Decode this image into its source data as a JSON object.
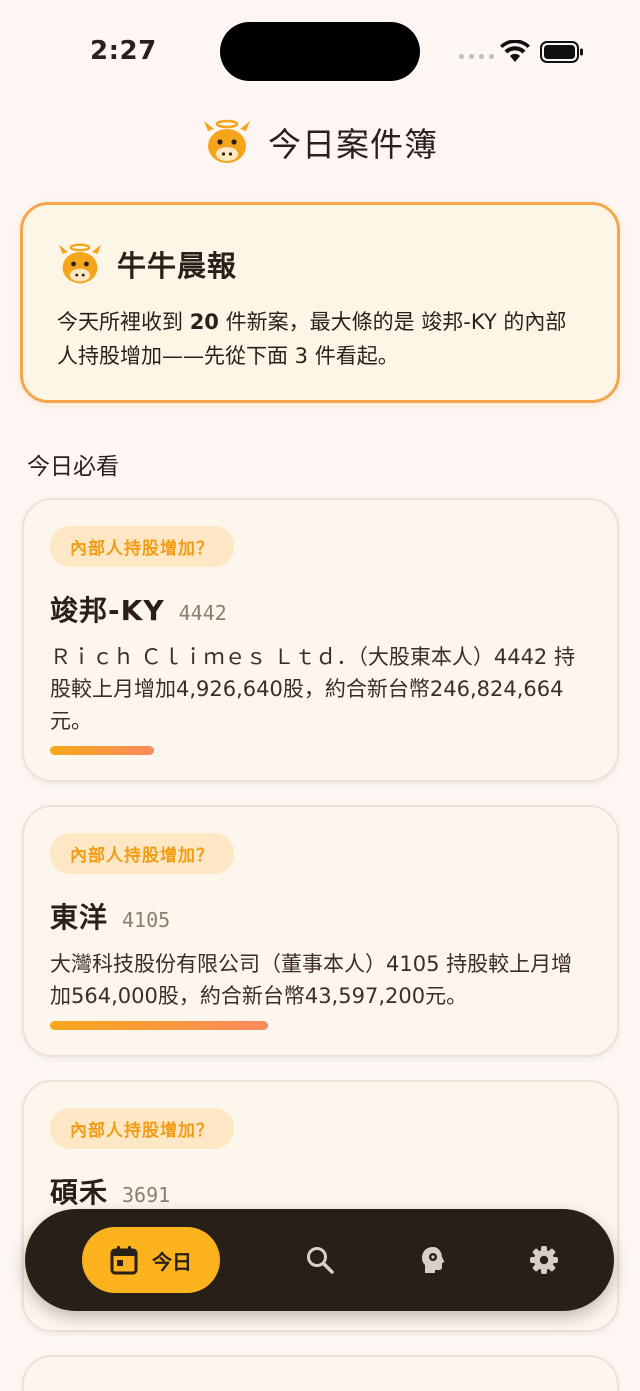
{
  "status": {
    "time": "2:27"
  },
  "header": {
    "title": "今日案件簿",
    "logo_icon": "bull-mascot-icon"
  },
  "brief": {
    "title": "牛牛晨報",
    "body_pre": "今天所裡收到 ",
    "count": "20",
    "body_mid": " 件新案，最大條的是 竣邦-KY 的內部人持股增加——先從下面 3 件看起。"
  },
  "section": {
    "title": "今日必看"
  },
  "cases": [
    {
      "tag": "內部人持股增加？",
      "company": "竣邦-KY",
      "code": "4442",
      "desc": "Ｒｉｃｈ Ｃｌｉｍｅｓ Ｌｔｄ．（大股東本人）4442 持股較上月增加4,926,640股，約合新台幣246,824,664元。",
      "progress": 0.19
    },
    {
      "tag": "內部人持股增加？",
      "company": "東洋",
      "code": "4105",
      "desc": "大灣科技股份有限公司（董事本人）4105 持股較上月增加564,000股，約合新台幣43,597,200元。",
      "progress": 0.4
    },
    {
      "tag": "內部人持股增加？",
      "company": "碩禾",
      "code": "3691",
      "desc": "",
      "progress": 0
    }
  ],
  "nav": {
    "today_label": "今日",
    "items": [
      "calendar-icon",
      "search-icon",
      "insight-head-icon",
      "settings-gear-icon"
    ]
  },
  "colors": {
    "accent": "#fbb21c",
    "tag_text": "#f39c12",
    "tag_bg": "#fde7c4",
    "nav_bg": "#271f1a",
    "page_bg": "#fdf6f2"
  }
}
